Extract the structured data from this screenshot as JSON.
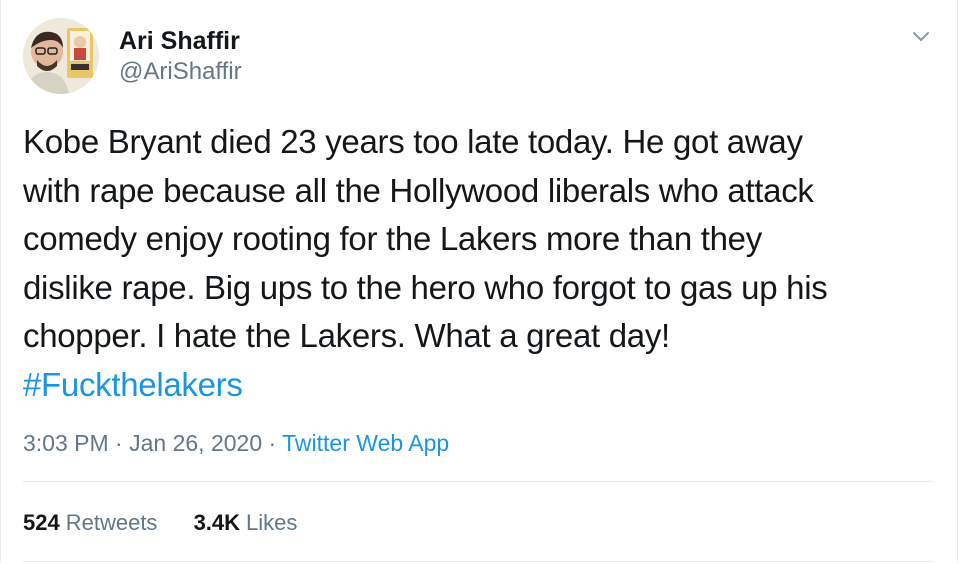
{
  "author": {
    "name": "Ari Shaffir",
    "handle": "@AriShaffir"
  },
  "tweet": {
    "lines": [
      "Kobe Bryant died 23 years too late today. He got away",
      "with rape because all the Hollywood liberals who attack",
      "comedy enjoy rooting for the Lakers more than they",
      "dislike rape. Big ups to the hero who forgot to gas up his",
      "chopper. I hate the Lakers. What a great day!"
    ],
    "hashtag": "#Fuckthelakers"
  },
  "meta": {
    "time": "3:03 PM",
    "separator": " · ",
    "date": "Jan 26, 2020",
    "source": "Twitter Web App"
  },
  "stats": {
    "retweets_count": "524",
    "retweets_label": "Retweets",
    "likes_count": "3.4K",
    "likes_label": "Likes"
  },
  "colors": {
    "link": "#1b95e0",
    "secondary_text": "#657786",
    "primary_text": "#14171a",
    "divider": "#e6ecf0"
  },
  "icons": {
    "menu": "chevron-down-icon",
    "avatar": "avatar"
  }
}
